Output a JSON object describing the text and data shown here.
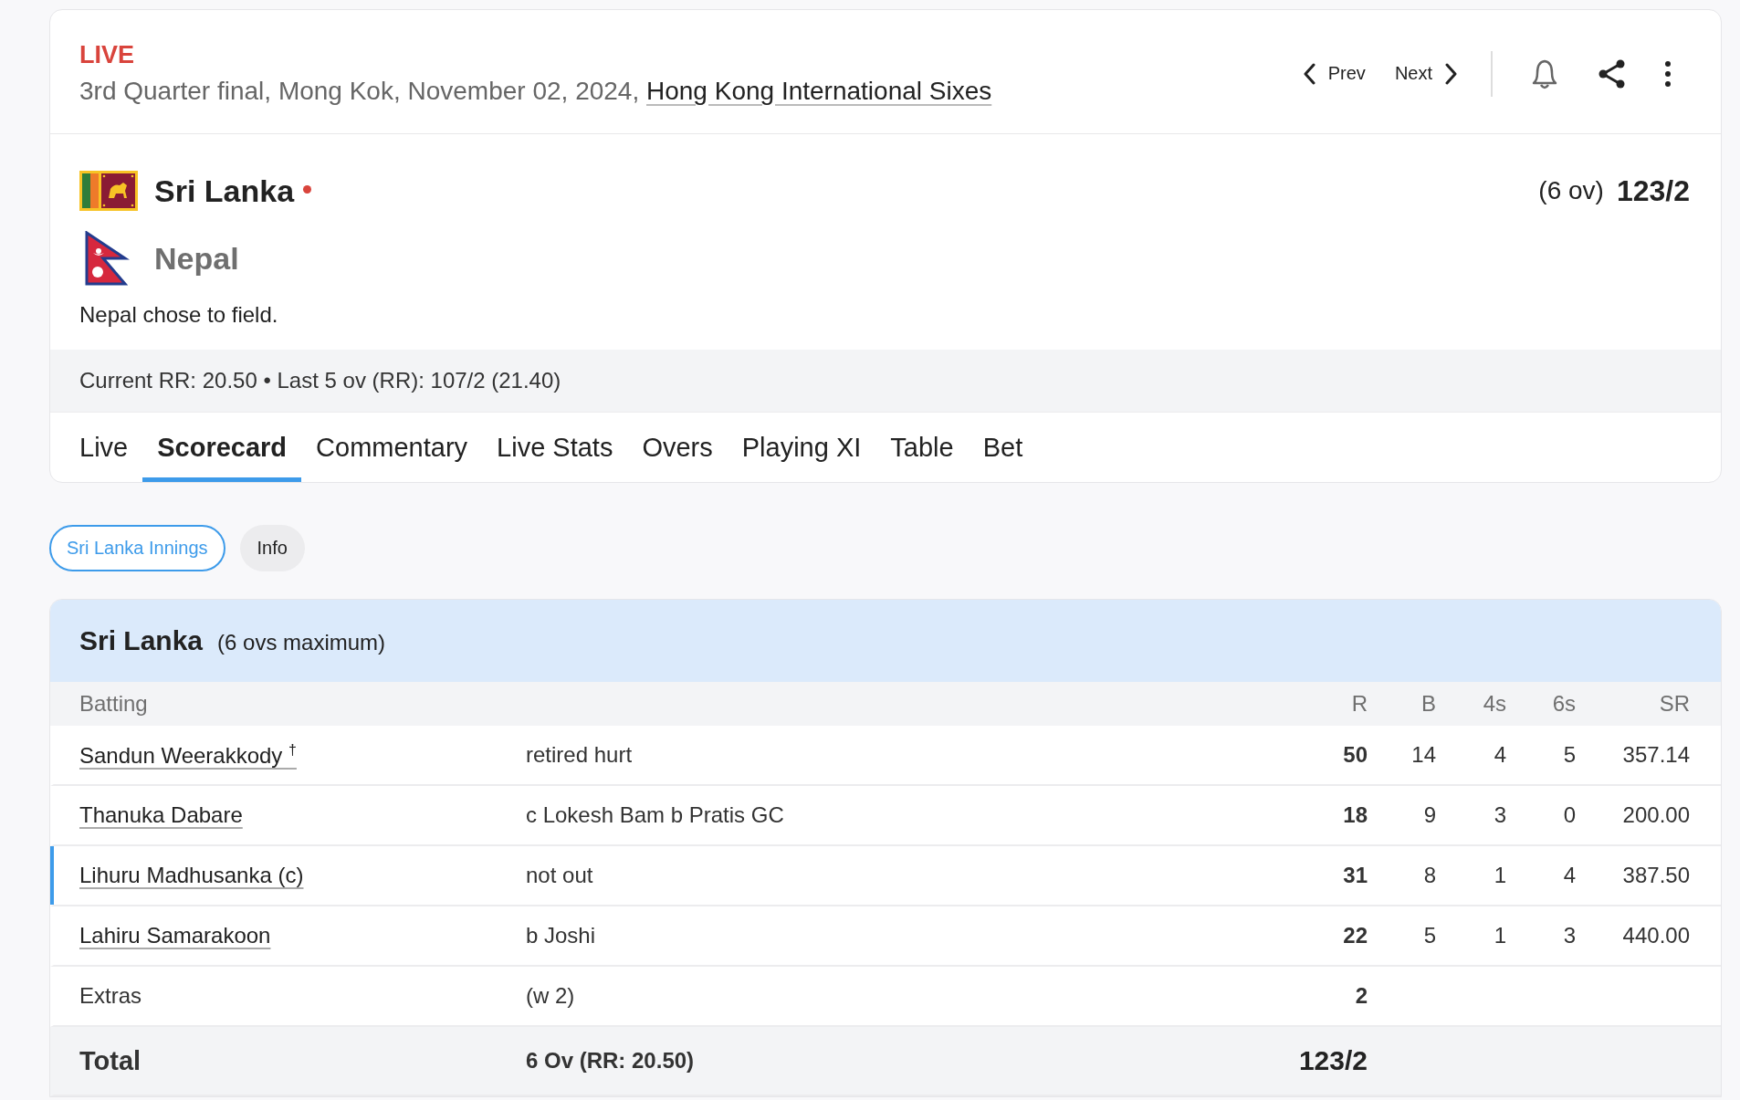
{
  "match": {
    "status": "LIVE",
    "description": "3rd Quarter final, Mong Kok, November 02, 2024, ",
    "series_link": "Hong Kong International Sixes",
    "nav": [
      {
        "kind": "prev",
        "label": "Prev"
      },
      {
        "kind": "next",
        "label": "Next"
      }
    ]
  },
  "teams": [
    {
      "name": "Sri Lanka",
      "kind": "sri_lanka",
      "batting": true,
      "overs": "(6 ov)",
      "score": "123/2"
    },
    {
      "name": "Nepal",
      "kind": "nepal",
      "batting": false
    }
  ],
  "toss": "Nepal chose to field.",
  "run_rate": "Current RR: 20.50 • Last 5 ov (RR): 107/2 (21.40)",
  "tabs": [
    {
      "label": "Live",
      "selected": false
    },
    {
      "label": "Scorecard",
      "selected": true
    },
    {
      "label": "Commentary",
      "selected": false
    },
    {
      "label": "Live Stats",
      "selected": false
    },
    {
      "label": "Overs",
      "selected": false
    },
    {
      "label": "Playing XI",
      "selected": false
    },
    {
      "label": "Table",
      "selected": false
    },
    {
      "label": "Bet",
      "selected": false
    }
  ],
  "innings_pills": [
    {
      "label": "Sri Lanka Innings",
      "selected": true
    },
    {
      "label": "Info",
      "selected": false
    }
  ],
  "innings": {
    "team": "Sri Lanka",
    "note": "(6 ovs maximum)",
    "columns": [
      "Batting",
      "R",
      "B",
      "4s",
      "6s",
      "SR"
    ],
    "batters": [
      {
        "name": "Sandun Weerakkody $^{†}$",
        "dismissal": "retired hurt",
        "r": "50",
        "b": "14",
        "fours": "4",
        "sixes": "5",
        "sr": "357.14",
        "highlighted": false
      },
      {
        "name": "Thanuka Dabare",
        "dismissal": "c Lokesh Bam b Pratis GC",
        "r": "18",
        "b": "9",
        "fours": "3",
        "sixes": "0",
        "sr": "200.00",
        "highlighted": false
      },
      {
        "name": "Lihuru Madhusanka (c)",
        "dismissal": "not out",
        "r": "31",
        "b": "8",
        "fours": "1",
        "sixes": "4",
        "sr": "387.50",
        "highlighted": true
      },
      {
        "name": "Lahiru Samarakoon",
        "dismissal": "b Joshi",
        "r": "22",
        "b": "5",
        "fours": "1",
        "sixes": "3",
        "sr": "440.00",
        "highlighted": false
      }
    ],
    "extras": {
      "label": "Extras",
      "detail": "(w 2)",
      "runs": "2"
    },
    "total": {
      "label": "Total",
      "detail": "6 Ov (RR: 20.50)",
      "runs": "123/2"
    }
  }
}
